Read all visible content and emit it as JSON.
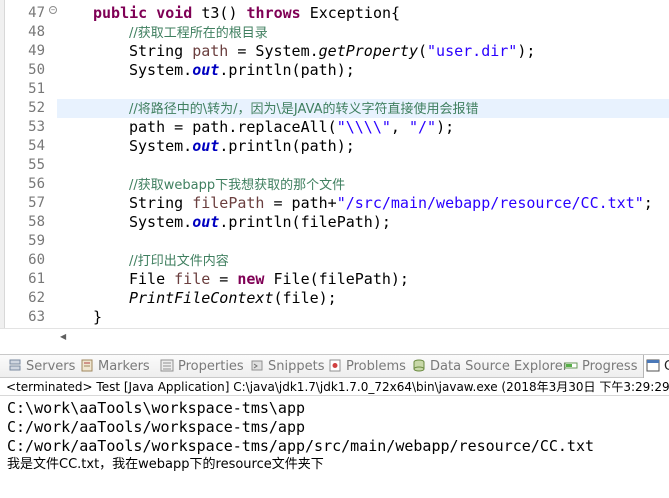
{
  "editor": {
    "line_numbers": [
      "47",
      "48",
      "49",
      "50",
      "51",
      "52",
      "53",
      "54",
      "55",
      "56",
      "57",
      "58",
      "59",
      "60",
      "61",
      "62",
      "63"
    ],
    "fold_marker": "−",
    "lines": {
      "l47": {
        "kw1": "public",
        "kw2": "void",
        "name": " t3() ",
        "kw3": "throws",
        "rest": " Exception{"
      },
      "l48": {
        "comment": "//获取工程所在的根目录"
      },
      "l49": {
        "type": "String ",
        "var": "path",
        "mid": " = System.",
        "method": "getProperty",
        "open": "(",
        "str": "\"user.dir\"",
        "close": ");"
      },
      "l50": {
        "pre": "System.",
        "field": "out",
        "post": ".println(path);"
      },
      "l52": {
        "comment": "//将路径中的\\转为/，因为\\是JAVA的转义字符直接使用会报错"
      },
      "l53": {
        "pre": "path = path.replaceAll(",
        "str1": "\"\\\\\\\\\"",
        "sep": ", ",
        "str2": "\"/\"",
        "post": ");"
      },
      "l54": {
        "pre": "System.",
        "field": "out",
        "post": ".println(path);"
      },
      "l56": {
        "comment": "//获取webapp下我想获取的那个文件"
      },
      "l57": {
        "type": "String ",
        "var": "filePath",
        "mid": " = path+",
        "str": "\"/src/main/webapp/resource/CC.txt\"",
        "post": ";"
      },
      "l58": {
        "pre": "System.",
        "field": "out",
        "post": ".println(filePath);"
      },
      "l60": {
        "comment": "//打印出文件内容"
      },
      "l61": {
        "type": "File ",
        "var": "file",
        "mid": " = ",
        "kw": "new",
        "post": " File(filePath);"
      },
      "l62": {
        "method": "PrintFileContext",
        "post": "(file);"
      },
      "l63": {
        "brace": "}"
      }
    }
  },
  "views_tabs": [
    {
      "label": "Servers",
      "icon": "servers-icon"
    },
    {
      "label": "Markers",
      "icon": "markers-icon"
    },
    {
      "label": "Properties",
      "icon": "properties-icon"
    },
    {
      "label": "Snippets",
      "icon": "snippets-icon"
    },
    {
      "label": "Problems",
      "icon": "problems-icon"
    },
    {
      "label": "Data Source Explorer",
      "icon": "data-source-icon"
    },
    {
      "label": "Progress",
      "icon": "progress-icon"
    },
    {
      "label": "C",
      "icon": "console-icon"
    }
  ],
  "console": {
    "header": "<terminated> Test [Java Application] C:\\java\\jdk1.7\\jdk1.7.0_72x64\\bin\\javaw.exe (2018年3月30日 下午3:29:29)",
    "output": [
      "C:\\work\\aaTools\\workspace-tms\\app",
      "C:/work/aaTools/workspace-tms/app",
      "C:/work/aaTools/workspace-tms/app/src/main/webapp/resource/CC.txt",
      "我是文件CC.txt，我在webapp下的resource文件夹下"
    ]
  },
  "colors": {
    "keyword": "#7f0055",
    "comment": "#3f7f5f",
    "string": "#2a00ff",
    "static_field": "#0000c0",
    "current_line": "#e8f2fe"
  }
}
